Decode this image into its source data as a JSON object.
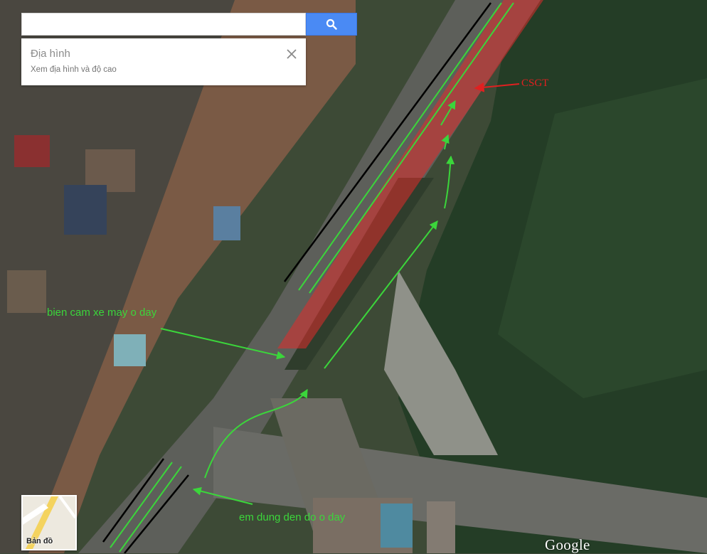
{
  "search": {
    "value": "",
    "placeholder": "",
    "button_icon": "search-icon"
  },
  "info_card": {
    "title": "Địa hình",
    "subtitle": "Xem địa hình và độ cao",
    "close_icon": "close-icon"
  },
  "layer_switch": {
    "label": "Bản đồ"
  },
  "logo": {
    "text": "Google"
  },
  "annotations": {
    "no_motorbike": "bien cam xe may o day",
    "red_light_stop": "em dung den do o day",
    "police": "CSGT"
  },
  "colors": {
    "search_button": "#4a8af4",
    "annotation_green": "#3bd63b",
    "annotation_red": "#e02020",
    "red_zone": "#e02b2b",
    "road": "#5d5f5a",
    "vegetation": "#2e4a2c"
  }
}
